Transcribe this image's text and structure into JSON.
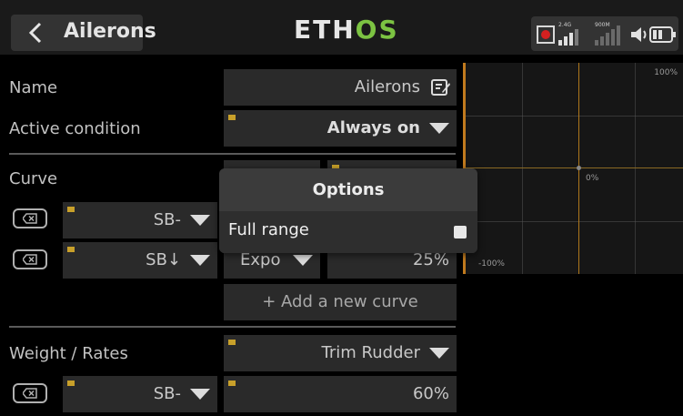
{
  "header": {
    "title": "Ailerons",
    "brand_part1": "ETH",
    "brand_part2": "OS",
    "signal_label_24": "2.4G",
    "signal_label_900": "900M"
  },
  "form": {
    "name_label": "Name",
    "name_value": "Ailerons",
    "active_condition_label": "Active condition",
    "active_condition_value": "Always on",
    "curve_label": "Curve",
    "curve_row1_switch": "SB-",
    "curve_row2_switch": "SB↓",
    "curve_row2_type": "Expo",
    "curve_row2_value": "25%",
    "add_curve_label": "+ Add a new curve",
    "weight_label": "Weight / Rates",
    "weight_source": "Trim Rudder",
    "weight_row_switch": "SB-",
    "weight_row_value": "60%"
  },
  "graph": {
    "label_top": "100%",
    "label_mid": "0%",
    "label_bottom": "-100%"
  },
  "modal": {
    "title": "Options",
    "option_label": "Full range",
    "option_checked": false
  }
}
